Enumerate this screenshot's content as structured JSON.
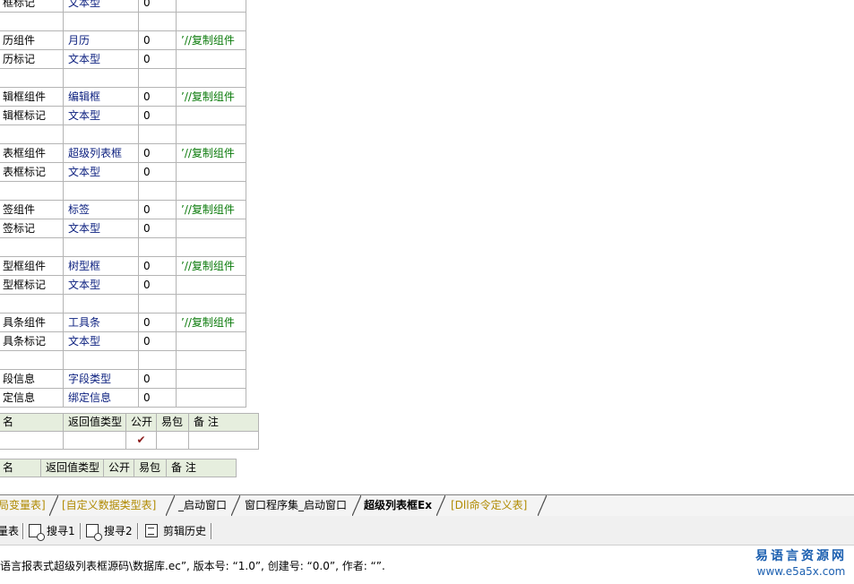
{
  "members": [
    {
      "name": "框标记",
      "type": "文本型",
      "array": "0",
      "note": ""
    },
    {
      "name": "",
      "type": "",
      "array": "",
      "note": ""
    },
    {
      "name": "历组件",
      "type": "月历",
      "array": "0",
      "note": "’//复制组件"
    },
    {
      "name": "历标记",
      "type": "文本型",
      "array": "0",
      "note": ""
    },
    {
      "name": "",
      "type": "",
      "array": "",
      "note": ""
    },
    {
      "name": "辑框组件",
      "type": "编辑框",
      "array": "0",
      "note": "’//复制组件"
    },
    {
      "name": "辑框标记",
      "type": "文本型",
      "array": "0",
      "note": ""
    },
    {
      "name": "",
      "type": "",
      "array": "",
      "note": ""
    },
    {
      "name": "表框组件",
      "type": "超级列表框",
      "array": "0",
      "note": "’//复制组件"
    },
    {
      "name": "表框标记",
      "type": "文本型",
      "array": "0",
      "note": ""
    },
    {
      "name": "",
      "type": "",
      "array": "",
      "note": ""
    },
    {
      "name": "签组件",
      "type": "标签",
      "array": "0",
      "note": "’//复制组件"
    },
    {
      "name": "签标记",
      "type": "文本型",
      "array": "0",
      "note": ""
    },
    {
      "name": "",
      "type": "",
      "array": "",
      "note": ""
    },
    {
      "name": "型框组件",
      "type": "树型框",
      "array": "0",
      "note": "’//复制组件"
    },
    {
      "name": "型框标记",
      "type": "文本型",
      "array": "0",
      "note": ""
    },
    {
      "name": "",
      "type": "",
      "array": "",
      "note": ""
    },
    {
      "name": "具条组件",
      "type": "工具条",
      "array": "0",
      "note": "’//复制组件"
    },
    {
      "name": "具条标记",
      "type": "文本型",
      "array": "0",
      "note": ""
    },
    {
      "name": "",
      "type": "",
      "array": "",
      "note": ""
    },
    {
      "name": "段信息",
      "type": "字段类型",
      "array": "0",
      "note": ""
    },
    {
      "name": "定信息",
      "type": "绑定信息",
      "array": "0",
      "note": ""
    }
  ],
  "sub1": {
    "headers": [
      "名",
      "返回值类型",
      "公开",
      "易包",
      "备 注"
    ],
    "row": {
      "name": "",
      "ret": "",
      "public_check": "✔",
      "pkg": "",
      "note": ""
    }
  },
  "sub2": {
    "headers": [
      "名",
      "返回值类型",
      "公开",
      "易包",
      "备 注"
    ]
  },
  "tabs": [
    {
      "label": "局变量表]",
      "state": "inactive"
    },
    {
      "label": "[自定义数据类型表]",
      "state": "inactive"
    },
    {
      "label": "_启动窗口",
      "state": "normal"
    },
    {
      "label": "窗口程序集_启动窗口",
      "state": "normal"
    },
    {
      "label": "超级列表框Ex",
      "state": "active"
    },
    {
      "label": "[Dll命令定义表]",
      "state": "inactive"
    }
  ],
  "toolbar": {
    "var_table": "量表",
    "search1": "搜寻1",
    "search2": "搜寻2",
    "clip_history": "剪辑历史"
  },
  "status": {
    "text": "语言报表式超级列表框源码\\数据库.ec”, 版本号: “1.0”, 创建号: “0.0”, 作者: “”."
  },
  "logo": {
    "name": "易语言资源网",
    "url": "www.e5a5x.com"
  }
}
